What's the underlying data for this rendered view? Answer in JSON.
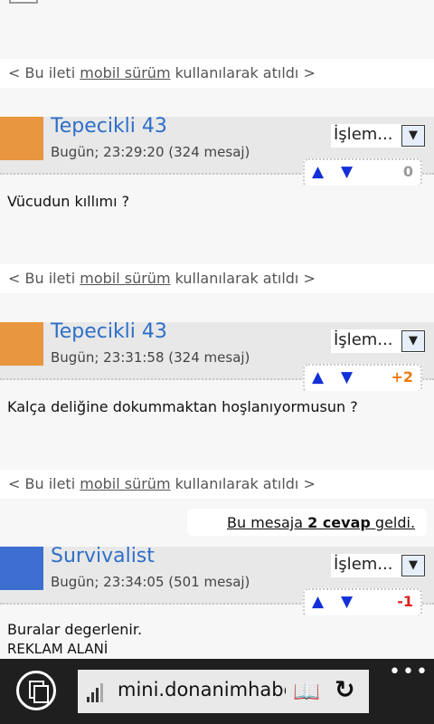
{
  "footer": {
    "prefix": "< Bu ileti ",
    "link": "mobil sürüm",
    "suffix": " kullanılarak atıldı >"
  },
  "posts": [
    {
      "username": "Tepecikli 43",
      "date": "Bugün; 23:29:20 (324 mesaj)",
      "avatar_color": "#e8963f",
      "action_label": "İşlem...",
      "action_arrow": "▼",
      "vote_up": "▲",
      "vote_down": "▼",
      "score": "0",
      "score_color": "#9a9a9a",
      "body_lines": [
        "Vücudun kıllımı ?"
      ]
    },
    {
      "username": "Tepecikli 43",
      "date": "Bugün; 23:31:58 (324 mesaj)",
      "avatar_color": "#e8963f",
      "action_label": "İşlem...",
      "action_arrow": "▼",
      "vote_up": "▲",
      "vote_down": "▼",
      "score": "+2",
      "score_color": "#f07a12",
      "body_lines": [
        "Kalça deliğine dokummaktan hoşlanıyormusun ?"
      ]
    },
    {
      "username": "Survivalist",
      "date": "Bugün; 23:34:05 (501 mesaj)",
      "avatar_color": "#3d6fd0",
      "action_label": "İşlem...",
      "action_arrow": "▼",
      "vote_up": "▲",
      "vote_down": "▼",
      "score": "-1",
      "score_color": "#e02020",
      "body_lines": [
        "Buralar degerlenir.",
        "REKLAM ALANİ"
      ]
    }
  ],
  "reply_notice": {
    "prefix": "Bu mesaja ",
    "count": "2 cevap",
    "suffix": " geldi."
  },
  "address_bar": {
    "url": "mini.donanimhaber.com",
    "tabs_icon": "tabs-icon",
    "signal_icon": "signal-icon",
    "reader_icon": "reading-view-icon",
    "refresh_icon": "refresh-icon",
    "reader_glyph": "📖",
    "refresh_glyph": "↻",
    "more": "•••"
  }
}
